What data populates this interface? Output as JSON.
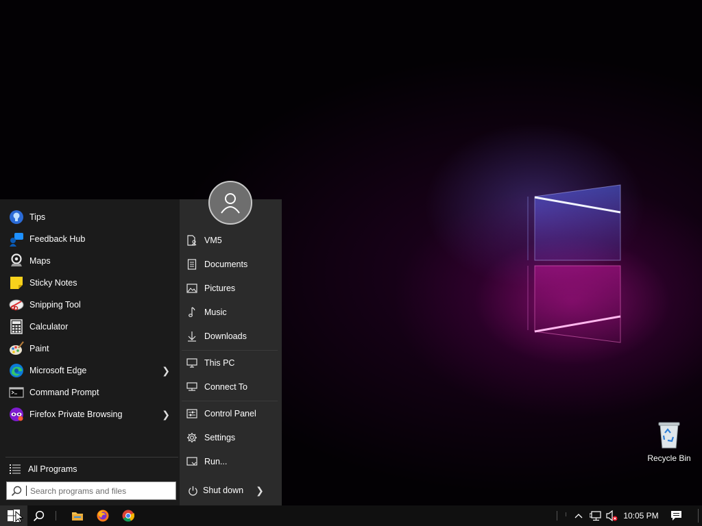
{
  "desktop": {
    "icons": [
      {
        "label": "Recycle Bin",
        "icon": "recycle-bin-icon"
      }
    ]
  },
  "start_menu": {
    "programs": [
      {
        "label": "Tips",
        "icon": "tips-icon",
        "has_submenu": false
      },
      {
        "label": "Feedback Hub",
        "icon": "feedback-hub-icon",
        "has_submenu": false
      },
      {
        "label": "Maps",
        "icon": "maps-icon",
        "has_submenu": false
      },
      {
        "label": "Sticky Notes",
        "icon": "sticky-notes-icon",
        "has_submenu": false
      },
      {
        "label": "Snipping Tool",
        "icon": "snipping-tool-icon",
        "has_submenu": false
      },
      {
        "label": "Calculator",
        "icon": "calculator-icon",
        "has_submenu": false
      },
      {
        "label": "Paint",
        "icon": "paint-icon",
        "has_submenu": false
      },
      {
        "label": "Microsoft Edge",
        "icon": "edge-icon",
        "has_submenu": true
      },
      {
        "label": "Command Prompt",
        "icon": "command-prompt-icon",
        "has_submenu": false
      },
      {
        "label": "Firefox Private Browsing",
        "icon": "firefox-private-icon",
        "has_submenu": true
      }
    ],
    "all_programs_label": "All Programs",
    "search_placeholder": "Search programs and files",
    "places": [
      {
        "label": "VM5",
        "icon": "user-folder-icon"
      },
      {
        "label": "Documents",
        "icon": "documents-icon"
      },
      {
        "label": "Pictures",
        "icon": "pictures-icon"
      },
      {
        "label": "Music",
        "icon": "music-icon"
      },
      {
        "label": "Downloads",
        "icon": "downloads-icon"
      },
      {
        "label": "This PC",
        "icon": "this-pc-icon"
      },
      {
        "label": "Connect To",
        "icon": "connect-to-icon"
      },
      {
        "label": "Control Panel",
        "icon": "control-panel-icon"
      },
      {
        "label": "Settings",
        "icon": "settings-gear-icon"
      },
      {
        "label": "Run...",
        "icon": "run-icon"
      }
    ],
    "shutdown_label": "Shut down"
  },
  "taskbar": {
    "pinned": [
      {
        "name": "file-explorer",
        "icon": "folder-icon"
      },
      {
        "name": "firefox",
        "icon": "firefox-icon"
      },
      {
        "name": "chrome",
        "icon": "chrome-icon"
      }
    ],
    "tray": {
      "clock": "10:05 PM",
      "icons": [
        "show-hidden-icons-chevron",
        "network-icon",
        "volume-muted-icon",
        "notifications-icon"
      ]
    }
  },
  "colors": {
    "menu_left_bg": "#1b1b1b",
    "menu_right_bg": "#2b2b2b",
    "taskbar_bg": "#101010",
    "accent_magenta": "#c814a0"
  }
}
